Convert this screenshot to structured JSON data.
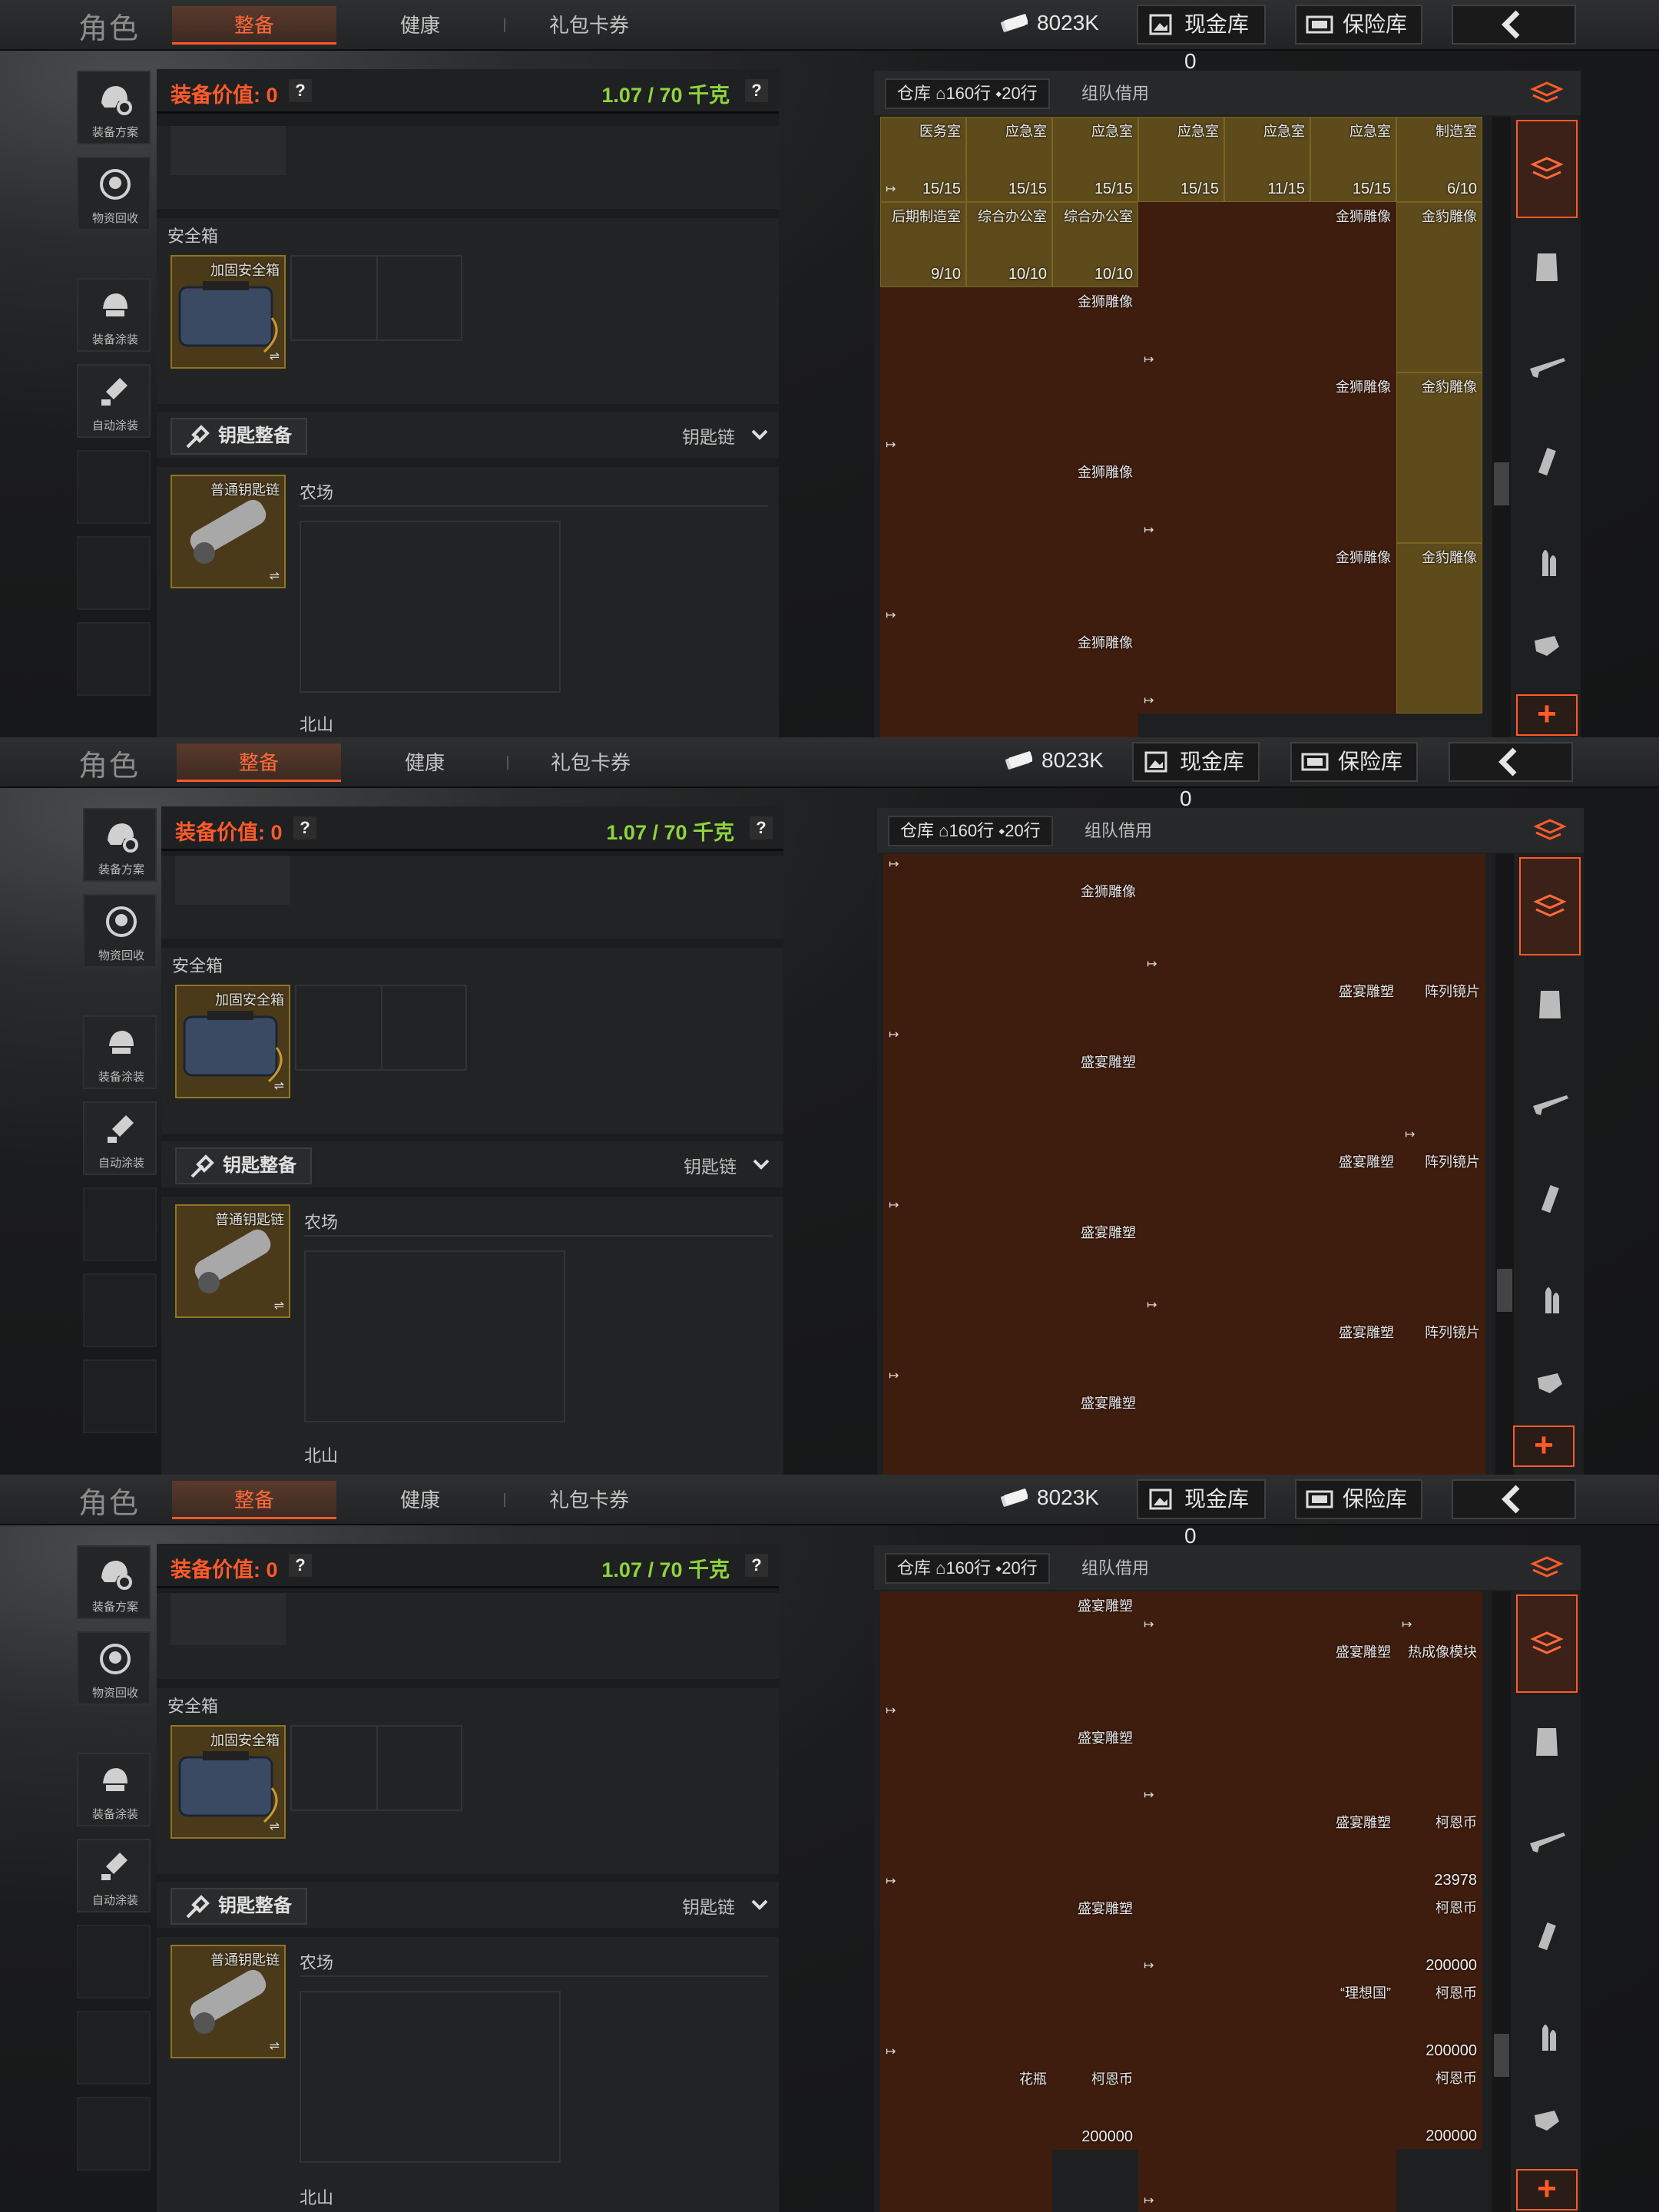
{
  "topbar": {
    "title": "角色",
    "tabs": [
      {
        "label": "整备"
      },
      {
        "label": "健康"
      },
      {
        "label": "礼包卡券"
      }
    ],
    "currency_value": "8023K",
    "cash_vault_label": "现金库 0",
    "safe_vault_label": "保险库"
  },
  "sidenav": {
    "items": [
      {
        "label": "装备方案",
        "icon": "helmet-gear-icon"
      },
      {
        "label": "物资回收",
        "icon": "recycle-icon"
      },
      {
        "label": "装备涂装",
        "icon": "paint-helmet-icon"
      },
      {
        "label": "自动涂装",
        "icon": "auto-paint-icon"
      }
    ]
  },
  "loadout": {
    "equip_value_label": "装备价值: 0",
    "weight_label": "1.07 / 70 千克",
    "help_glyph": "?",
    "safebox_section": "安全箱",
    "safebox_item": "加固安全箱",
    "key_button": "钥匙整备",
    "keychain_dropdown": "钥匙链",
    "keychain_item": "普通钥匙链",
    "key_area_1": "农场",
    "key_area_2": "北山",
    "swap_glyph": "⇌"
  },
  "warehouse": {
    "tab_label": "仓库",
    "rows_label": "160行",
    "cols_label": "20行",
    "team_tab": "组队借用",
    "plus_glyph": "+"
  },
  "panels": [
    {
      "cells": [
        {
          "name": "医务室",
          "count": "15/15"
        },
        {
          "name": "应急室",
          "count": "15/15"
        },
        {
          "name": "应急室",
          "count": "15/15"
        },
        {
          "name": "应急室",
          "count": "15/15"
        },
        {
          "name": "应急室",
          "count": "11/15"
        },
        {
          "name": "应急室",
          "count": "15/15"
        },
        {
          "name": "制造室",
          "count": "6/10"
        },
        {
          "name": "后期制造室",
          "count": "9/10"
        },
        {
          "name": "综合办公室",
          "count": "10/10"
        },
        {
          "name": "综合办公室",
          "count": "10/10"
        },
        {
          "name": "金狮雕像",
          "count": ""
        },
        {
          "name": "金豹雕像",
          "count": ""
        },
        {
          "name": "金狮雕像",
          "count": ""
        },
        {
          "name": "金狮雕像",
          "count": ""
        },
        {
          "name": "金豹雕像",
          "count": ""
        },
        {
          "name": "金狮雕像",
          "count": ""
        },
        {
          "name": "金狮雕像",
          "count": ""
        },
        {
          "name": "金豹雕像",
          "count": ""
        },
        {
          "name": "金狮雕像",
          "count": ""
        }
      ]
    },
    {
      "cells": [
        {
          "name": "金狮雕像",
          "count": ""
        },
        {
          "name": "",
          "count": ""
        },
        {
          "name": "",
          "count": ""
        },
        {
          "name": "盛宴雕塑",
          "count": ""
        },
        {
          "name": "阵列镜片",
          "count": ""
        },
        {
          "name": "盛宴雕塑",
          "count": ""
        },
        {
          "name": "盛宴雕塑",
          "count": ""
        },
        {
          "name": "阵列镜片",
          "count": ""
        },
        {
          "name": "盛宴雕塑",
          "count": ""
        },
        {
          "name": "盛宴雕塑",
          "count": ""
        },
        {
          "name": "阵列镜片",
          "count": ""
        },
        {
          "name": "盛宴雕塑",
          "count": ""
        }
      ]
    },
    {
      "cells": [
        {
          "name": "盛宴雕塑",
          "count": ""
        },
        {
          "name": "盛宴雕塑",
          "count": ""
        },
        {
          "name": "热成像模块",
          "count": ""
        },
        {
          "name": "盛宴雕塑",
          "count": ""
        },
        {
          "name": "盛宴雕塑",
          "count": ""
        },
        {
          "name": "柯恩币",
          "count": "23978"
        },
        {
          "name": "盛宴雕塑",
          "count": ""
        },
        {
          "name": "柯恩币",
          "count": "200000"
        },
        {
          "name": "“理想国”",
          "count": ""
        },
        {
          "name": "柯恩币",
          "count": "200000"
        },
        {
          "name": "花瓶",
          "count": ""
        },
        {
          "name": "柯恩币",
          "count": "200000"
        },
        {
          "name": "柯恩币",
          "count": "200000"
        }
      ]
    }
  ],
  "colors": {
    "accent": "#ff5a28",
    "weight_green": "#8ed43e",
    "gold_cell": "#5d4b1c",
    "brown_cell": "#3f1d0e"
  }
}
